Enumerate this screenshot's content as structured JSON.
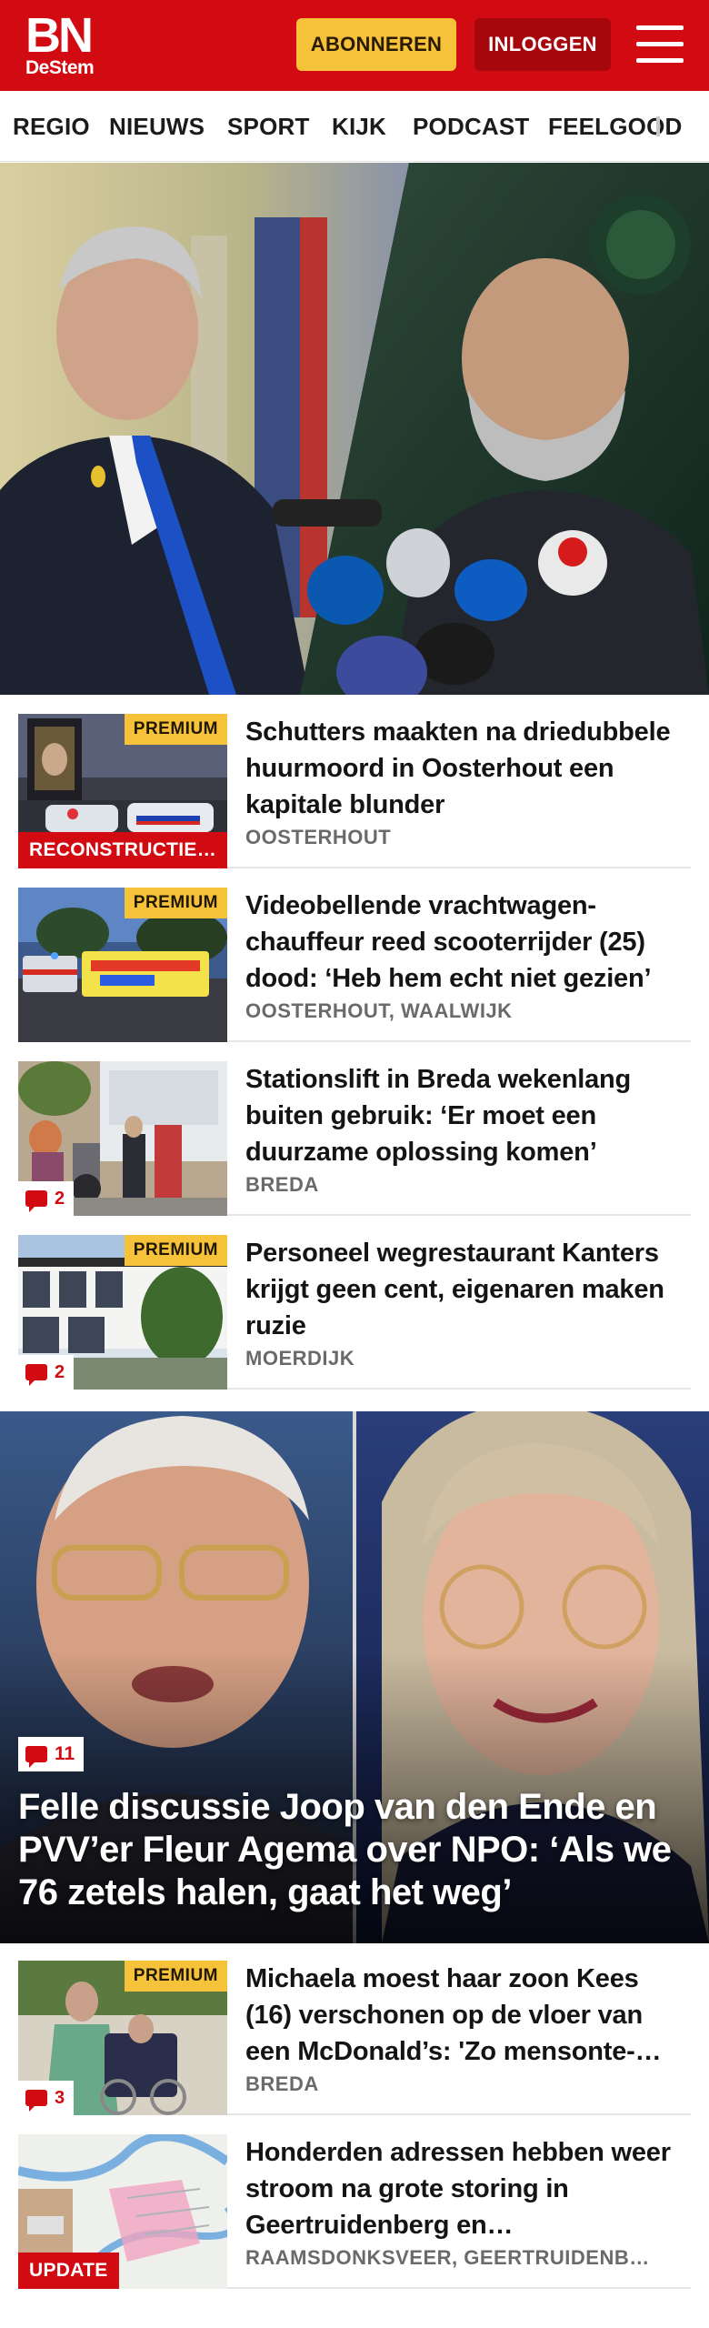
{
  "header": {
    "logo_main": "BN",
    "logo_sub": "DeStem",
    "subscribe_label": "ABONNEREN",
    "login_label": "INLOGGEN",
    "brand_color": "#d20b12",
    "accent_color": "#f5c23a"
  },
  "nav": {
    "items": [
      "REGIO",
      "NIEUWS",
      "SPORT",
      "KIJK",
      "PODCAST",
      "FEELGOOD"
    ]
  },
  "hero": {
    "image": "two politicians at press conferences, split image"
  },
  "articles": [
    {
      "title": "Schutters maakten na driedubbele huurmoord in Oosterhout een kapitale blunder",
      "tag": "OOSTERHOUT",
      "premium": "PREMIUM",
      "label": "RECONSTRUCTIE ...",
      "comments": null
    },
    {
      "title": "Videobellende vrachtwagen-chauffeur reed scooterrijder (25) dood: ‘Heb hem echt niet gezien’",
      "tag": "OOSTERHOUT, WAALWIJK",
      "premium": "PREMIUM",
      "label": null,
      "comments": null
    },
    {
      "title": "Stationslift in Breda wekenlang buiten gebruik: ‘Er moet een duurzame oplossing komen’",
      "tag": "BREDA",
      "premium": null,
      "label": null,
      "comments": "2"
    },
    {
      "title": "Personeel wegrestaurant Kanters krijgt geen cent, eigenaren maken ruzie",
      "tag": "MOERDIJK",
      "premium": "PREMIUM",
      "label": null,
      "comments": "2"
    }
  ],
  "feature": {
    "comments": "11",
    "title": "Felle discussie Joop van den Ende en PVV’er Fleur Agema over NPO: ‘Als we 76 zetels halen, gaat het weg’"
  },
  "articles2": [
    {
      "title": "Michaela moest haar zoon Kees (16) verschonen op de vloer van een McDonald’s: 'Zo mensonte-…",
      "tag": "BREDA",
      "premium": "PREMIUM",
      "label": null,
      "comments": "3"
    },
    {
      "title": "Honderden adressen hebben weer stroom na grote storing in Geertruidenberg en…",
      "tag": "RAAMSDONKSVEER, GEERTRUIDENB…",
      "premium": null,
      "label": "UPDATE",
      "comments": null
    }
  ]
}
